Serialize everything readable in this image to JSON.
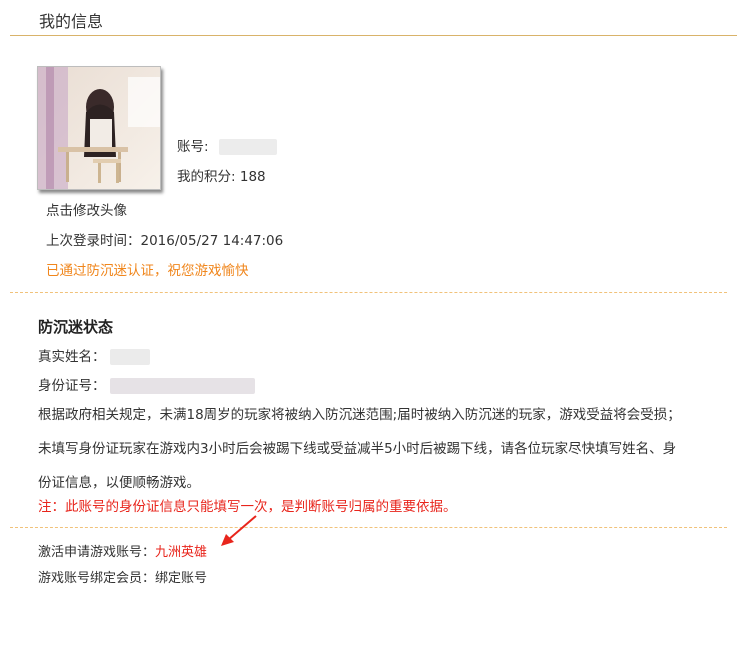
{
  "page_title": "我的信息",
  "account": {
    "account_label": "账号:",
    "points_label": "我的积分:",
    "points_value": "188"
  },
  "avatar_caption": "点击修改头像",
  "last_login_label": "上次登录时间：",
  "last_login_value": "2016/05/27 14:47:06",
  "anti_addiction_passed": "已通过防沉迷认证，祝您游戏愉快",
  "status": {
    "heading": "防沉迷状态",
    "real_name_label": "真实姓名：",
    "id_number_label": "身份证号：",
    "policy_text": "根据政府相关规定，未满18周岁的玩家将被纳入防沉迷范围;届时被纳入防沉迷的玩家，游戏受益将会受损；未填写身份证玩家在游戏内3小时后会被踢下线或受益减半5小时后被踢下线，请各位玩家尽快填写姓名、身份证信息，以便顺畅游戏。",
    "note": "注：此账号的身份证信息只能填写一次，是判断账号归属的重要依据。"
  },
  "activation": {
    "label": "激活申请游戏账号：",
    "value": "九洲英雄"
  },
  "binding": {
    "label": "游戏账号绑定会员：",
    "value": "绑定账号"
  },
  "colors": {
    "accent_line": "#d9b36a",
    "dashed": "#f1c27a",
    "orange": "#f0861c",
    "red": "#e8251c"
  }
}
